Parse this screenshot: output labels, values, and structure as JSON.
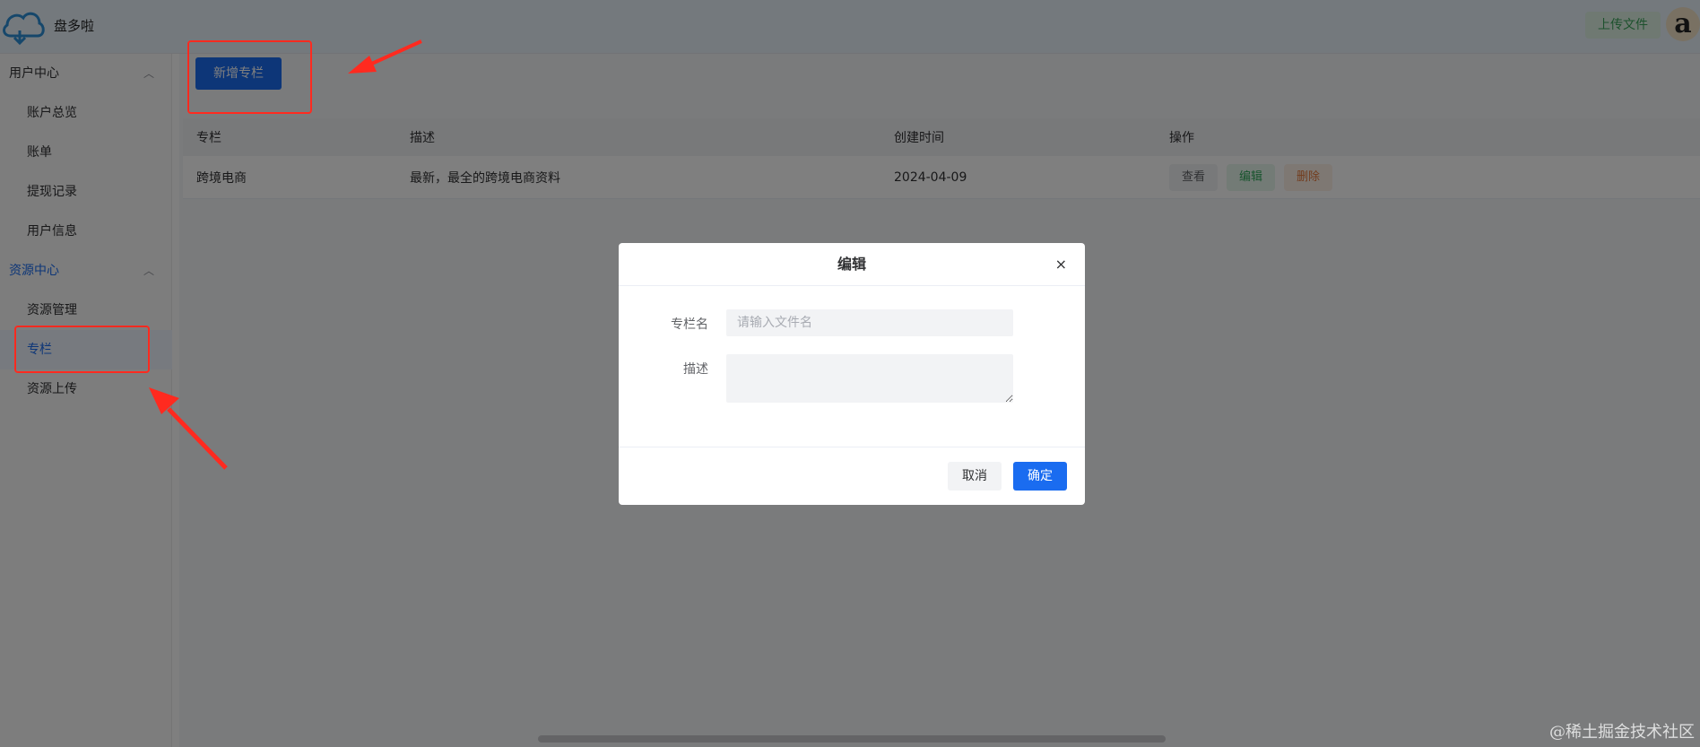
{
  "header": {
    "logo_text": "盘多啦",
    "upload_label": "上传文件",
    "avatar_letter": "a"
  },
  "sidebar": {
    "groups": [
      {
        "label": "用户中心",
        "items": [
          {
            "label": "账户总览"
          },
          {
            "label": "账单"
          },
          {
            "label": "提现记录"
          },
          {
            "label": "用户信息"
          }
        ]
      },
      {
        "label": "资源中心",
        "items": [
          {
            "label": "资源管理"
          },
          {
            "label": "专栏"
          },
          {
            "label": "资源上传"
          }
        ]
      }
    ],
    "active_item": "专栏"
  },
  "main": {
    "add_button_label": "新增专栏",
    "table": {
      "columns": [
        "专栏",
        "描述",
        "创建时间",
        "操作"
      ],
      "rows": [
        {
          "name": "跨境电商",
          "description": "最新，最全的跨境电商资料",
          "created": "2024-04-09",
          "actions": [
            "查看",
            "编辑",
            "删除"
          ]
        }
      ]
    }
  },
  "dialog": {
    "title": "编辑",
    "close_icon": "×",
    "name_label": "专栏名",
    "name_placeholder": "请输入文件名",
    "name_value": "",
    "desc_label": "描述",
    "desc_value": "",
    "cancel_label": "取消",
    "confirm_label": "确定"
  },
  "watermark": "@稀土掘金技术社区",
  "colors": {
    "primary": "#1a6cf0",
    "annotation_red": "#ff2a1f",
    "success": "#2fa85b",
    "warning": "#e57a3c"
  }
}
